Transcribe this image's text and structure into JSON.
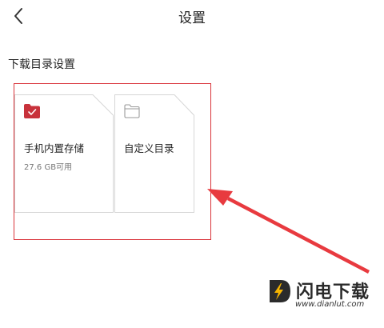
{
  "header": {
    "title": "设置",
    "back_icon": "chevron-left-icon"
  },
  "section": {
    "title": "下载目录设置"
  },
  "cards": [
    {
      "label": "手机内置存储",
      "sub": "27.6 GB可用",
      "icon": "folder-check-icon",
      "selected": true
    },
    {
      "label": "自定义目录",
      "icon": "folder-outline-icon",
      "selected": false
    }
  ],
  "watermark": {
    "brand": "闪电下载",
    "url": "www.dianlut.com"
  },
  "colors": {
    "accent": "#c8323b",
    "highlight": "#d9333a",
    "arrow": "#e83a3f",
    "logo_bg": "#2b2b2b",
    "logo_bolt": "#f5b400"
  }
}
